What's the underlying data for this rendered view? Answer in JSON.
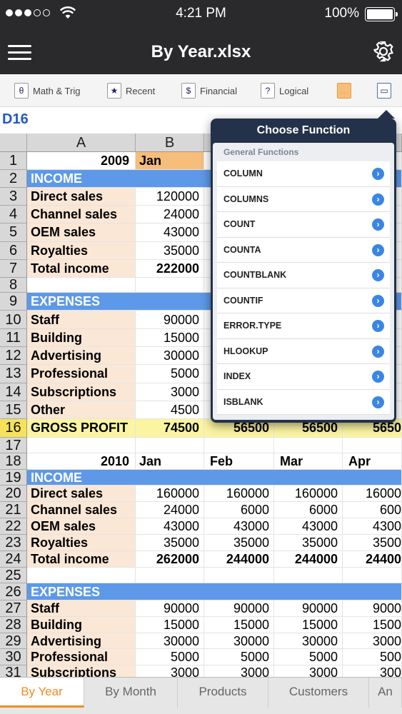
{
  "status": {
    "time": "4:21 PM",
    "battery": "100%"
  },
  "nav": {
    "title": "By Year.xlsx"
  },
  "toolbar": {
    "items": [
      "Math & Trig",
      "Recent",
      "Financial",
      "Logical"
    ]
  },
  "cell_ref": "D16",
  "columns": [
    "A",
    "B"
  ],
  "rows": [
    {
      "n": "1",
      "type": "year",
      "a": "2009",
      "b": "Jan"
    },
    {
      "n": "2",
      "type": "section",
      "a": "INCOME"
    },
    {
      "n": "3",
      "type": "data",
      "a": "Direct sales",
      "b": "120000"
    },
    {
      "n": "4",
      "type": "data",
      "a": "Channel sales",
      "b": "24000"
    },
    {
      "n": "5",
      "type": "data",
      "a": "OEM sales",
      "b": "43000"
    },
    {
      "n": "6",
      "type": "data",
      "a": "Royalties",
      "b": "35000"
    },
    {
      "n": "7",
      "type": "total",
      "a": "Total income",
      "b": "222000"
    },
    {
      "n": "8",
      "type": "blank"
    },
    {
      "n": "9",
      "type": "section",
      "a": "EXPENSES"
    },
    {
      "n": "10",
      "type": "data",
      "a": "Staff",
      "b": "90000"
    },
    {
      "n": "11",
      "type": "data",
      "a": "Building",
      "b": "15000"
    },
    {
      "n": "12",
      "type": "data",
      "a": "Advertising",
      "b": "30000"
    },
    {
      "n": "13",
      "type": "data",
      "a": "Professional",
      "b": "5000"
    },
    {
      "n": "14",
      "type": "data",
      "a": "Subscriptions",
      "b": "3000"
    },
    {
      "n": "15",
      "type": "data",
      "a": "Other",
      "b": "4500"
    },
    {
      "n": "16",
      "type": "gp",
      "a": "GROSS PROFIT",
      "b": "74500",
      "c": "56500",
      "d": "56500",
      "e": "5650"
    },
    {
      "n": "17",
      "type": "blank"
    },
    {
      "n": "18",
      "type": "year2",
      "a": "2010",
      "b": "Jan",
      "c": "Feb",
      "d": "Mar",
      "e": "Apr"
    },
    {
      "n": "19",
      "type": "section",
      "a": "INCOME"
    },
    {
      "n": "20",
      "type": "data",
      "a": "Direct sales",
      "b": "160000",
      "c": "160000",
      "d": "160000",
      "e": "16000"
    },
    {
      "n": "21",
      "type": "data",
      "a": "Channel sales",
      "b": "24000",
      "c": "6000",
      "d": "6000",
      "e": "600"
    },
    {
      "n": "22",
      "type": "data",
      "a": "OEM sales",
      "b": "43000",
      "c": "43000",
      "d": "43000",
      "e": "4300"
    },
    {
      "n": "23",
      "type": "data",
      "a": "Royalties",
      "b": "35000",
      "c": "35000",
      "d": "35000",
      "e": "3500"
    },
    {
      "n": "24",
      "type": "total",
      "a": "Total income",
      "b": "262000",
      "c": "244000",
      "d": "244000",
      "e": "24400"
    },
    {
      "n": "25",
      "type": "blank"
    },
    {
      "n": "26",
      "type": "section",
      "a": "EXPENSES"
    },
    {
      "n": "27",
      "type": "data",
      "a": "Staff",
      "b": "90000",
      "c": "90000",
      "d": "90000",
      "e": "9000"
    },
    {
      "n": "28",
      "type": "data",
      "a": "Building",
      "b": "15000",
      "c": "15000",
      "d": "15000",
      "e": "1500"
    },
    {
      "n": "29",
      "type": "data",
      "a": "Advertising",
      "b": "30000",
      "c": "30000",
      "d": "30000",
      "e": "3000"
    },
    {
      "n": "30",
      "type": "data",
      "a": "Professional",
      "b": "5000",
      "c": "5000",
      "d": "5000",
      "e": "500"
    },
    {
      "n": "31",
      "type": "data",
      "a": "Subscriptions",
      "b": "3000",
      "c": "3000",
      "d": "3000",
      "e": "300"
    }
  ],
  "popover": {
    "title": "Choose Function",
    "section": "General Functions",
    "items": [
      "COLUMN",
      "COLUMNS",
      "COUNT",
      "COUNTA",
      "COUNTBLANK",
      "COUNTIF",
      "ERROR.TYPE",
      "HLOOKUP",
      "INDEX",
      "ISBLANK"
    ]
  },
  "tabs": [
    "By Year",
    "By Month",
    "Products",
    "Customers",
    "An"
  ],
  "active_tab": "By Year"
}
